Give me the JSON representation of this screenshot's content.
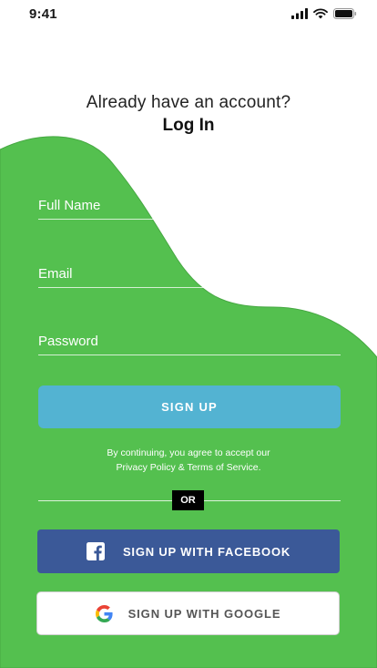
{
  "status_bar": {
    "time": "9:41"
  },
  "header": {
    "question": "Already have an account?",
    "login_link": "Log In"
  },
  "form": {
    "full_name": {
      "placeholder": "Full Name",
      "value": ""
    },
    "email": {
      "placeholder": "Email",
      "value": ""
    },
    "password": {
      "placeholder": "Password",
      "value": ""
    },
    "signup_label": "SIGN UP",
    "terms_line1": "By continuing, you agree to accept our",
    "privacy_link": "Privacy Policy",
    "terms_amp": " & ",
    "terms_link": "Terms of Service",
    "terms_end": "."
  },
  "divider": {
    "label": "OR"
  },
  "social": {
    "facebook_label": "SIGN UP WITH FACEBOOK",
    "google_label": "SIGN UP WITH GOOGLE"
  },
  "colors": {
    "accent_green": "#54c04f",
    "signup_blue": "#53b3d2",
    "facebook_blue": "#3b5998"
  }
}
